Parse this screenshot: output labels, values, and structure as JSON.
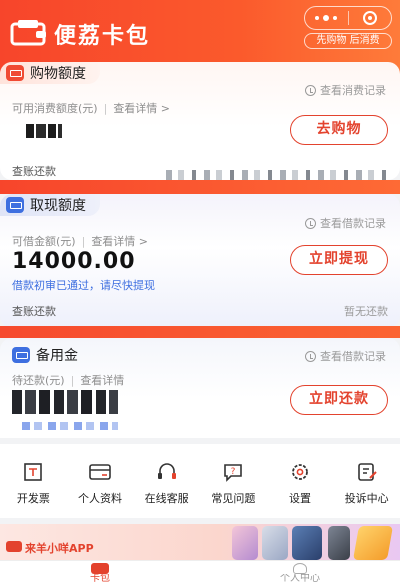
{
  "header": {
    "app_title": "便荔卡包",
    "slogan": "先购物 后消费"
  },
  "shopping_card": {
    "title": "购物额度",
    "record_link": "查看消费记录",
    "available_label": "可用消费额度(元)",
    "detail_link": "查看详情 >",
    "action_label": "去购物",
    "footer_left": "查账还款"
  },
  "cash_card": {
    "title": "取现额度",
    "record_link": "查看借款记录",
    "available_label": "可借金额(元)",
    "detail_link": "查看详情 >",
    "amount": "14000.00",
    "hint": "借款初审已通过，请尽快提现",
    "action_label": "立即提现",
    "footer_left": "查账还款",
    "footer_right": "暂无还款"
  },
  "reserve_card": {
    "title": "备用金",
    "record_link": "查看借款记录",
    "pending_label": "待还款(元)",
    "detail_link": "查看详情",
    "action_label": "立即还款"
  },
  "grid": {
    "items": [
      {
        "label": "开发票",
        "icon": "invoice-icon"
      },
      {
        "label": "个人资料",
        "icon": "id-card-icon"
      },
      {
        "label": "在线客服",
        "icon": "headset-icon"
      },
      {
        "label": "常见问题",
        "icon": "question-icon"
      },
      {
        "label": "设置",
        "icon": "gear-icon"
      },
      {
        "label": "投诉中心",
        "icon": "complaint-icon"
      }
    ]
  },
  "banner": {
    "text": "来羊小咩APP"
  },
  "tabbar": {
    "tabs": [
      {
        "label": "卡包",
        "active": true
      },
      {
        "label": "个人中心",
        "active": false
      }
    ]
  },
  "colors": {
    "brand_red": "#e3432e",
    "link_blue": "#3e6fe0"
  }
}
